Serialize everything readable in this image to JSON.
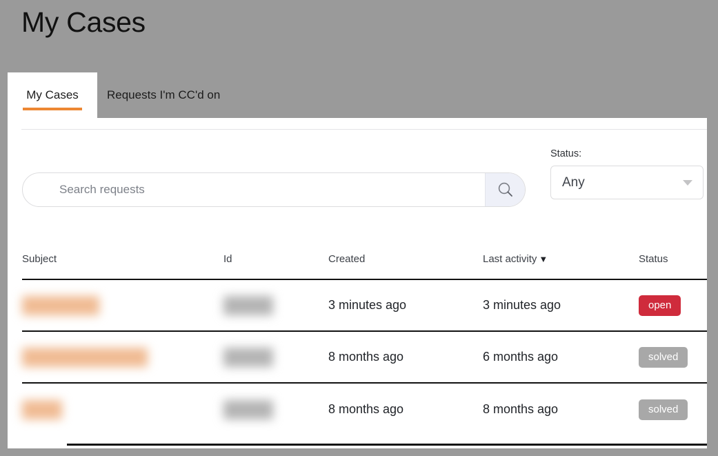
{
  "page": {
    "title": "My Cases"
  },
  "tabs": [
    {
      "label": "My Cases",
      "active": true
    },
    {
      "label": "Requests I'm CC'd on",
      "active": false
    }
  ],
  "search": {
    "placeholder": "Search requests",
    "value": "",
    "button_icon": "search-icon"
  },
  "status_filter": {
    "label": "Status:",
    "selected": "Any",
    "caret_icon": "chevron-down-icon"
  },
  "table": {
    "columns": [
      {
        "key": "subject",
        "label": "Subject"
      },
      {
        "key": "id",
        "label": "Id"
      },
      {
        "key": "created",
        "label": "Created"
      },
      {
        "key": "last_activity",
        "label": "Last activity"
      },
      {
        "key": "status",
        "label": "Status"
      }
    ],
    "sort": {
      "column": "Last activity",
      "direction": "desc",
      "arrow": "▼"
    },
    "rows": [
      {
        "subject": "",
        "subject_redacted": true,
        "subject_redact_width": 112,
        "id": "",
        "id_redacted": true,
        "created": "3 minutes ago",
        "last_activity": "3 minutes ago",
        "status": "open",
        "status_color": "#cf2b3c"
      },
      {
        "subject": "",
        "subject_redacted": true,
        "subject_redact_width": 182,
        "id": "",
        "id_redacted": true,
        "created": "8 months ago",
        "last_activity": "6 months ago",
        "status": "solved",
        "status_color": "#a8a8a8"
      },
      {
        "subject": "",
        "subject_redacted": true,
        "subject_redact_width": 58,
        "id": "",
        "id_redacted": true,
        "created": "8 months ago",
        "last_activity": "8 months ago",
        "status": "solved",
        "status_color": "#a8a8a8"
      }
    ]
  },
  "colors": {
    "background": "#9a9a9a",
    "accent": "#ed8733",
    "open": "#cf2b3c",
    "solved": "#a8a8a8",
    "search_button_bg": "#eef0f8"
  }
}
